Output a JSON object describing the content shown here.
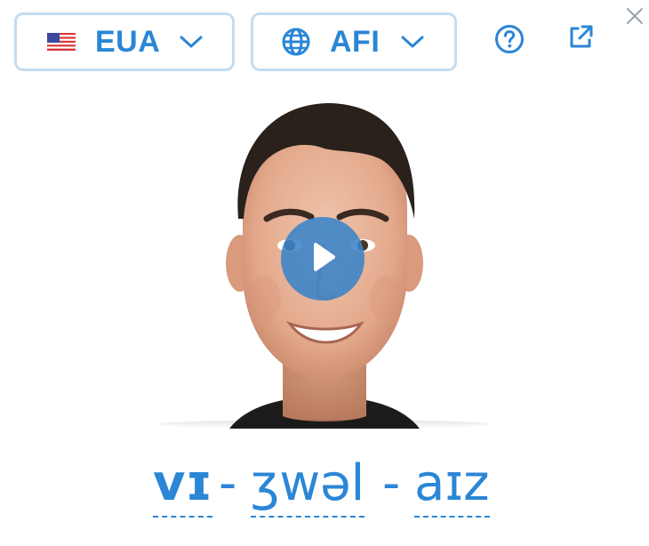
{
  "accent_selector": {
    "label": "EUA",
    "flag_icon": "us-flag-icon"
  },
  "notation_selector": {
    "label": "AFI",
    "icon": "globe-icon"
  },
  "toolbar": {
    "help_icon": "help-icon",
    "external_icon": "open-external-icon",
    "close_icon": "close-icon"
  },
  "video": {
    "play_icon": "play-icon"
  },
  "pronunciation": {
    "syllables": [
      "vɪ",
      "ʒwəl",
      "aɪz"
    ],
    "separator": "-"
  },
  "colors": {
    "accent": "#2b86d6",
    "border": "#c5dcf0",
    "play_button": "#3983c8",
    "close_icon": "#9aa3ab"
  }
}
